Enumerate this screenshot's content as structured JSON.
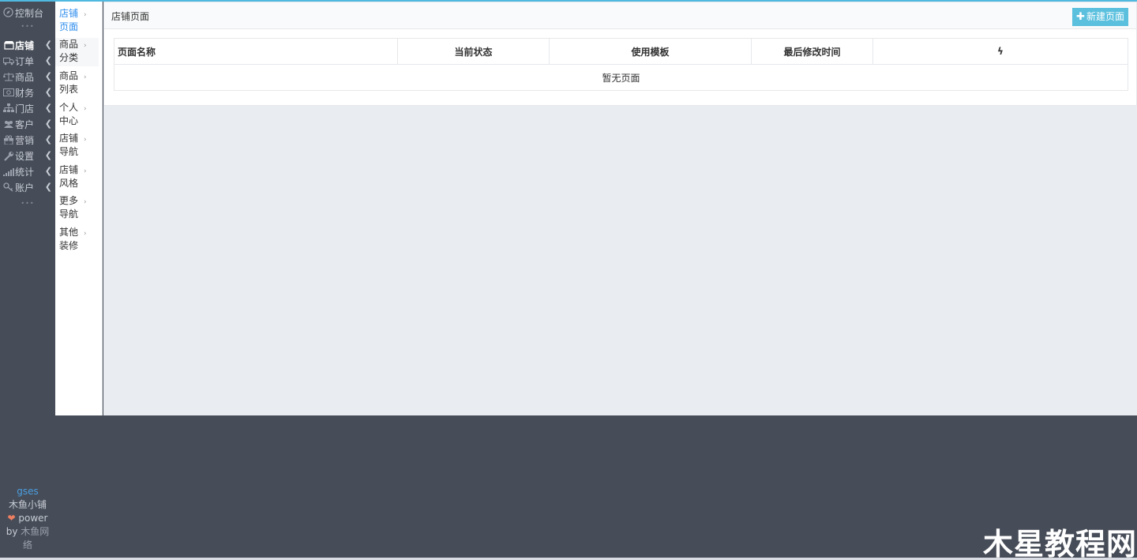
{
  "nav": {
    "console": {
      "label": "控制台",
      "icon": "compass-icon"
    },
    "dots": "•••",
    "items": [
      {
        "label": "店铺",
        "icon": "shop-icon",
        "active": true
      },
      {
        "label": "订单",
        "icon": "truck-icon"
      },
      {
        "label": "商品",
        "icon": "scale-icon"
      },
      {
        "label": "财务",
        "icon": "money-icon"
      },
      {
        "label": "门店",
        "icon": "sitemap-icon"
      },
      {
        "label": "客户",
        "icon": "users-icon"
      },
      {
        "label": "营销",
        "icon": "gift-icon"
      },
      {
        "label": "设置",
        "icon": "wrench-icon"
      },
      {
        "label": "统计",
        "icon": "signal-icon"
      },
      {
        "label": "账户",
        "icon": "key-icon"
      }
    ],
    "chevron": "❮",
    "footer": {
      "user": "gses",
      "shop": "木鱼小铺",
      "heart": "❤",
      "power": "power",
      "by": "by",
      "company": "木鱼网络"
    }
  },
  "subnav": {
    "arrow": "›",
    "items": [
      {
        "label": "店铺页面",
        "active": true
      },
      {
        "label": "商品分类",
        "hover": true
      },
      {
        "label": "商品列表"
      },
      {
        "label": "个人中心"
      },
      {
        "label": "店铺导航"
      },
      {
        "label": "店铺风格"
      },
      {
        "label": "更多导航"
      },
      {
        "label": "其他装修"
      }
    ]
  },
  "panel": {
    "title": "店铺页面",
    "new_button": "新建页面",
    "new_button_icon": "plus-icon"
  },
  "table": {
    "headers": [
      "页面名称",
      "当前状态",
      "使用模板",
      "最后修改时间",
      "ϟ"
    ],
    "empty_text": "暂无页面"
  },
  "watermark": "木星教程网",
  "colors": {
    "accent": "#5bc0de",
    "active_link": "#2e8ded",
    "sidebar": "#474d58",
    "topline": "#4fb9e0"
  }
}
